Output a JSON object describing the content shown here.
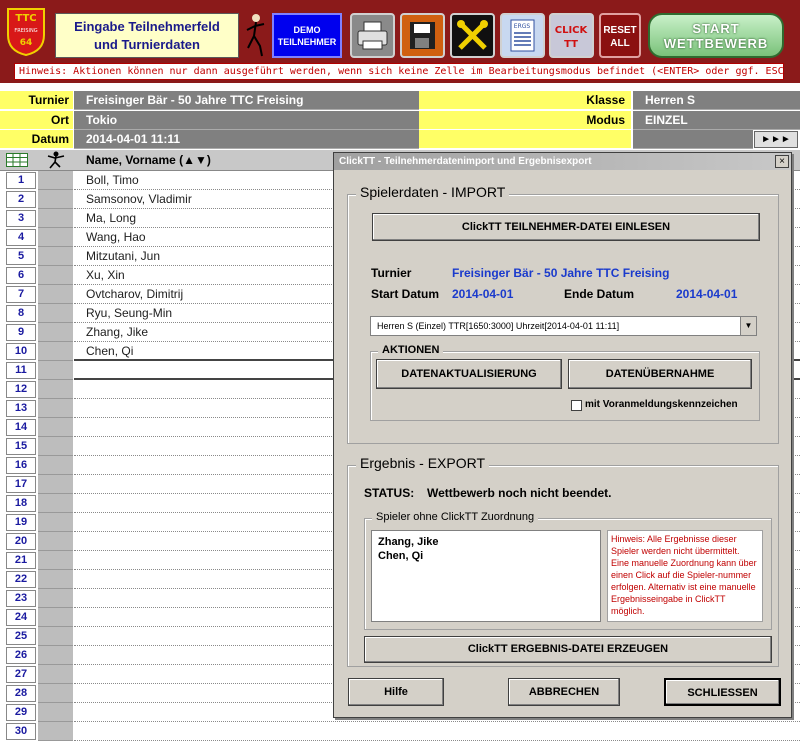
{
  "toolbar": {
    "logo_text_top": "TTC",
    "logo_text_mid": "FREISING",
    "logo_text_bottom": "64",
    "title_line1": "Eingabe Teilnehmerfeld",
    "title_line2": "und Turnierdaten",
    "demo_line1": "DEMO",
    "demo_line2": "TEILNEHMER",
    "ergs_label": "ERGS",
    "click_label": "CLICK",
    "tt_label": "TT",
    "reset_line1": "RESET",
    "reset_line2": "ALL",
    "start_line1": "START",
    "start_line2": "WETTBEWERB",
    "hint": "Hinweis: Aktionen können nur dann ausgeführt werden, wenn sich keine Zelle im Bearbeitungsmodus befindet (<ENTER> oder ggf. ESC drücken)"
  },
  "info": {
    "turnier_label": "Turnier",
    "turnier_value": "Freisinger Bär - 50 Jahre TTC Freising",
    "ort_label": "Ort",
    "ort_value": "Tokio",
    "datum_label": "Datum",
    "datum_value": "2014-04-01 11:11",
    "klasse_label": "Klasse",
    "klasse_value": "Herren S",
    "modus_label": "Modus",
    "modus_value": "EINZEL",
    "arrows": "►►►"
  },
  "sheet": {
    "name_header": "Name, Vorname (▲▼)",
    "rows": [
      {
        "n": "1",
        "name": "Boll, Timo"
      },
      {
        "n": "2",
        "name": "Samsonov, Vladimir"
      },
      {
        "n": "3",
        "name": "Ma, Long"
      },
      {
        "n": "4",
        "name": "Wang, Hao"
      },
      {
        "n": "5",
        "name": "Mitzutani, Jun"
      },
      {
        "n": "6",
        "name": "Xu, Xin"
      },
      {
        "n": "7",
        "name": "Ovtcharov, Dimitrij"
      },
      {
        "n": "8",
        "name": "Ryu, Seung-Min"
      },
      {
        "n": "9",
        "name": "Zhang, Jike"
      },
      {
        "n": "10",
        "name": "Chen, Qi"
      },
      {
        "n": "11",
        "name": ""
      },
      {
        "n": "12",
        "name": ""
      },
      {
        "n": "13",
        "name": ""
      },
      {
        "n": "14",
        "name": ""
      },
      {
        "n": "15",
        "name": ""
      },
      {
        "n": "16",
        "name": ""
      },
      {
        "n": "17",
        "name": ""
      },
      {
        "n": "18",
        "name": ""
      },
      {
        "n": "19",
        "name": ""
      },
      {
        "n": "20",
        "name": ""
      },
      {
        "n": "21",
        "name": ""
      },
      {
        "n": "22",
        "name": ""
      },
      {
        "n": "23",
        "name": ""
      },
      {
        "n": "24",
        "name": ""
      },
      {
        "n": "25",
        "name": ""
      },
      {
        "n": "26",
        "name": ""
      },
      {
        "n": "27",
        "name": ""
      },
      {
        "n": "28",
        "name": ""
      },
      {
        "n": "29",
        "name": ""
      },
      {
        "n": "30",
        "name": ""
      }
    ]
  },
  "dialog": {
    "title": "ClickTT - Teilnehmerdatenimport und Ergebnisexport",
    "close": "×",
    "import": {
      "frame_title": "Spielerdaten - IMPORT",
      "read_button": "ClickTT TEILNEHMER-DATEI EINLESEN",
      "turnier_label": "Turnier",
      "turnier_value": "Freisinger Bär - 50 Jahre TTC Freising",
      "start_label": "Start Datum",
      "start_value": "2014-04-01",
      "end_label": "Ende Datum",
      "end_value": "2014-04-01",
      "combo_value": "Herren S  (Einzel)  TTR[1650:3000]  Uhrzeit[2014-04-01 11:11]",
      "combo_arrow": "▼",
      "aktionen_title": "AKTIONEN",
      "update_button": "DATENAKTUALISIERUNG",
      "takeover_button": "DATENÜBERNAHME",
      "checkbox_label": "mit Voranmeldungskennzeichen"
    },
    "export": {
      "frame_title": "Ergebnis - EXPORT",
      "status_label": "STATUS:",
      "status_value": "Wettbewerb noch nicht beendet.",
      "players_frame_title": "Spieler ohne ClickTT Zuordnung",
      "players": [
        "Zhang, Jike",
        "Chen, Qi"
      ],
      "hint": "Hinweis: Alle Ergebnisse dieser Spieler werden nicht übermittelt. Eine manuelle Zuordnung kann über einen Click auf die Spieler-nummer erfolgen. Alternativ ist eine manuelle Ergebnisseingabe in ClickTT möglich.",
      "create_button": "ClickTT ERGEBNIS-DATEI ERZEUGEN"
    },
    "footer": {
      "help_button": "Hilfe",
      "cancel_button": "ABBRECHEN",
      "close_button": "SCHLIESSEN"
    }
  }
}
